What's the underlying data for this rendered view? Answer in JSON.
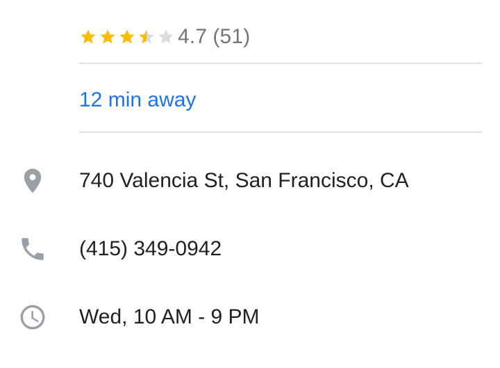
{
  "rating": {
    "value": "4.7",
    "count": "(51)",
    "stars": 3.5,
    "star_color": "#fbbc04",
    "star_empty_color": "#dadce0"
  },
  "eta": {
    "label": "12 min away",
    "color": "#1a73e8"
  },
  "details": {
    "address": {
      "icon": "location-pin-icon",
      "text": "740 Valencia St, San Francisco, CA"
    },
    "phone": {
      "icon": "phone-icon",
      "text": "(415) 349-0942"
    },
    "hours": {
      "icon": "clock-icon",
      "text": "Wed, 10 AM - 9 PM"
    }
  },
  "icon_color": "#9aa0a6"
}
